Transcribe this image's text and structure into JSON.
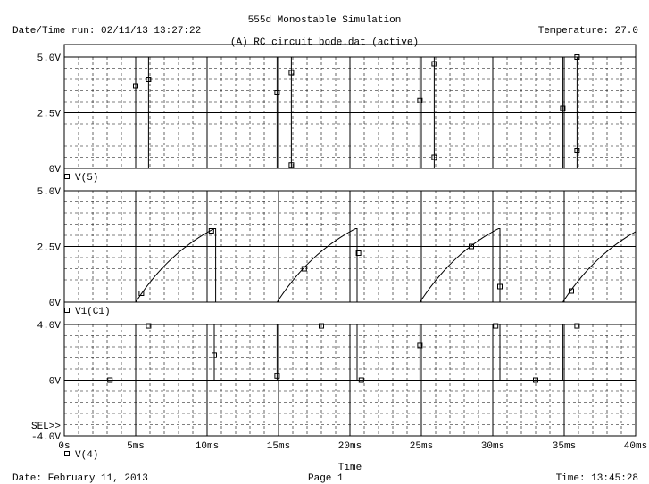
{
  "header": {
    "title": "555d Monostable Simulation",
    "run_label": "Date/Time run: 02/11/13 13:27:22",
    "temperature": "Temperature: 27.0",
    "file_label": "(A) RC circuit bode.dat (active)"
  },
  "footer": {
    "date": "Date: February 11, 2013",
    "page": "Page 1",
    "time": "Time: 13:45:28"
  },
  "chart_data": {
    "type": "line",
    "x": {
      "label": "Time",
      "range": [
        0,
        40
      ],
      "unit": "ms",
      "tick_values": [
        0,
        5,
        10,
        15,
        20,
        25,
        30,
        35,
        40
      ],
      "tick_labels": [
        "0s",
        "5ms",
        "10ms",
        "15ms",
        "20ms",
        "25ms",
        "30ms",
        "35ms",
        "40ms"
      ]
    },
    "sel_marker": "SEL>>",
    "grid": true,
    "panels": [
      {
        "name": "V(5)",
        "ylim": [
          0,
          5
        ],
        "y_ticks": [
          0,
          2.5,
          5
        ],
        "y_tick_labels": [
          "0V",
          "2.5V",
          "5.0V"
        ],
        "pulses": [
          [
            5.0,
            5.9
          ],
          [
            14.9,
            15.9
          ],
          [
            24.9,
            25.9
          ],
          [
            34.9,
            35.9
          ]
        ],
        "markers": [
          [
            5.0,
            3.7
          ],
          [
            5.9,
            4.0
          ],
          [
            14.9,
            3.4
          ],
          [
            15.9,
            0.15
          ],
          [
            15.9,
            4.3
          ],
          [
            24.9,
            3.05
          ],
          [
            25.9,
            0.5
          ],
          [
            25.9,
            4.7
          ],
          [
            34.9,
            2.7
          ],
          [
            35.9,
            0.8
          ],
          [
            35.9,
            5.0
          ]
        ]
      },
      {
        "name": "V1(C1)",
        "ylim": [
          0,
          5
        ],
        "y_ticks": [
          0,
          2.5,
          5
        ],
        "y_tick_labels": [
          "0V",
          "2.5V",
          "5.0V"
        ],
        "ramps": [
          {
            "start": 5.0,
            "peak_t": 10.5,
            "end": 10.6
          },
          {
            "start": 14.9,
            "peak_t": 20.4,
            "end": 20.5
          },
          {
            "start": 24.9,
            "peak_t": 30.4,
            "end": 30.5
          },
          {
            "start": 34.9,
            "peak_t": 40.0,
            "end": 40.0
          }
        ],
        "peak": 3.3,
        "markers": [
          [
            5.4,
            0.4
          ],
          [
            10.3,
            3.2
          ],
          [
            16.8,
            1.5
          ],
          [
            20.6,
            2.2
          ],
          [
            28.5,
            2.5
          ],
          [
            30.5,
            0.7
          ],
          [
            35.5,
            0.5
          ]
        ]
      },
      {
        "name": "V(4)",
        "ylim": [
          -4,
          4
        ],
        "y_ticks": [
          -4,
          0,
          4
        ],
        "y_tick_labels": [
          "-4.0V",
          "0V",
          "4.0V"
        ],
        "pulses": [
          [
            5.0,
            10.5
          ],
          [
            14.9,
            20.5
          ],
          [
            24.9,
            30.5
          ],
          [
            34.9,
            40.0
          ]
        ],
        "level_high": 4.0,
        "markers": [
          [
            3.2,
            0.0
          ],
          [
            5.9,
            3.9
          ],
          [
            10.5,
            1.8
          ],
          [
            14.9,
            0.3
          ],
          [
            18.0,
            3.9
          ],
          [
            20.8,
            0.0
          ],
          [
            24.9,
            2.5
          ],
          [
            30.2,
            3.9
          ],
          [
            33.0,
            0.0
          ],
          [
            35.9,
            3.9
          ]
        ]
      }
    ]
  }
}
